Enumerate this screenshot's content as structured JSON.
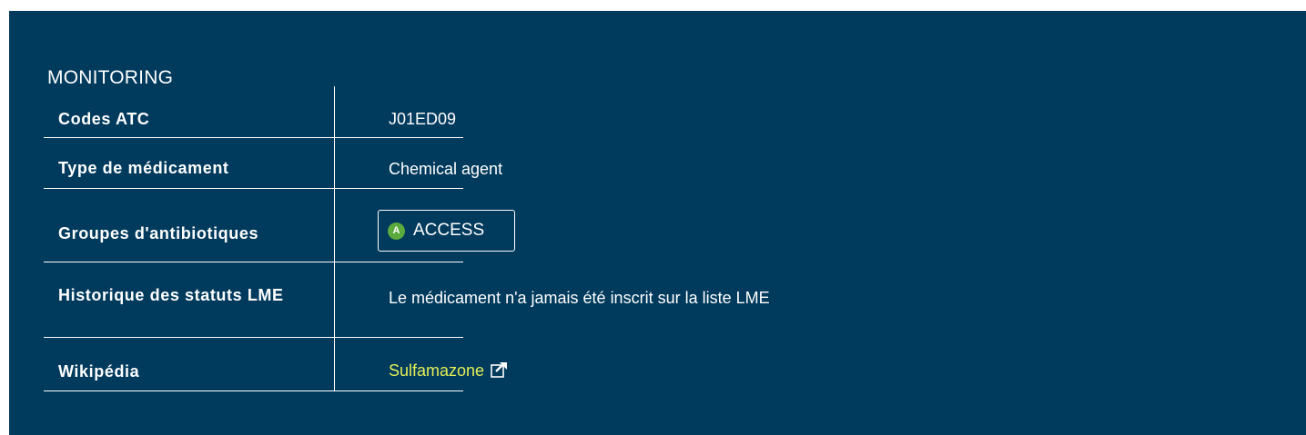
{
  "section": {
    "title": "MONITORING"
  },
  "rows": [
    {
      "label": "Codes ATC",
      "value": "J01ED09"
    },
    {
      "label": "Type de médicament",
      "value": "Chemical agent"
    },
    {
      "label": "Groupes d'antibiotiques",
      "badge_letter": "A",
      "badge_text": "ACCESS"
    },
    {
      "label": "Historique des statuts LME",
      "value": "Le médicament n'a jamais été inscrit sur la liste LME"
    },
    {
      "label": "Wikipédia",
      "link_text": "Sulfamazone",
      "link_icon": "external-link-icon"
    }
  ],
  "colors": {
    "panel_bg": "#003a5c",
    "link": "#e5f055",
    "access_badge": "#5aaa3c"
  }
}
